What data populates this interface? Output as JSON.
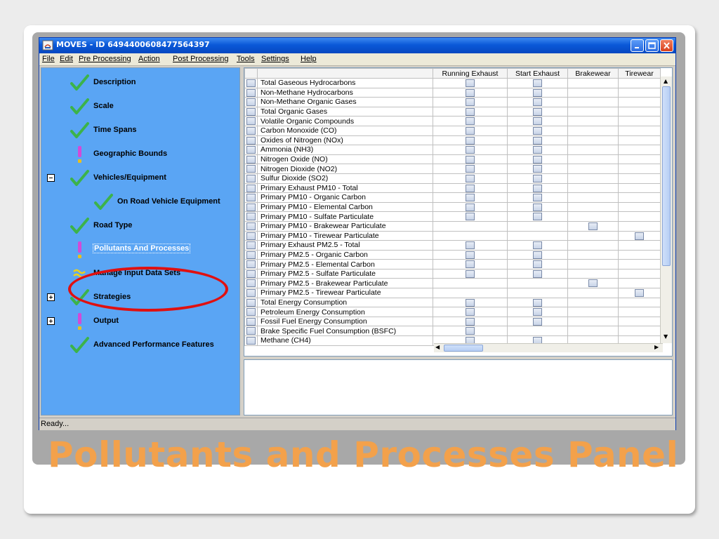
{
  "slide": {
    "title": "Pollutants and Processes Panel",
    "title_color": "#f3a14b"
  },
  "window": {
    "title": "MOVES - ID 6494400608477564397",
    "icon": "java-app-icon",
    "controls": [
      "minimize-icon",
      "maximize-icon",
      "close-icon"
    ]
  },
  "menu": [
    {
      "label": "File"
    },
    {
      "label": "Edit"
    },
    {
      "label": "Pre Processing"
    },
    {
      "label": "Action"
    },
    {
      "label": "Post Processing"
    },
    {
      "label": "Tools"
    },
    {
      "label": "Settings"
    },
    {
      "label": "Help"
    }
  ],
  "nav": {
    "items": [
      {
        "label": "Description",
        "status": "checkmark-icon"
      },
      {
        "label": "Scale",
        "status": "checkmark-icon"
      },
      {
        "label": "Time Spans",
        "status": "checkmark-icon"
      },
      {
        "label": "Geographic Bounds",
        "status": "exclamation-icon"
      },
      {
        "label": "Vehicles/Equipment",
        "status": "checkmark-icon",
        "expander": "collapse-icon"
      },
      {
        "label": "On Road Vehicle Equipment",
        "status": "checkmark-icon"
      },
      {
        "label": "Road Type",
        "status": "checkmark-icon"
      },
      {
        "label": "Pollutants And Processes",
        "status": "exclamation-icon",
        "selected": true
      },
      {
        "label": "Manage Input Data Sets",
        "status": "approx-icon"
      },
      {
        "label": "Strategies",
        "status": "checkmark-icon",
        "expander": "expand-icon"
      },
      {
        "label": "Output",
        "status": "exclamation-icon",
        "expander": "expand-icon"
      },
      {
        "label": "Advanced Performance Features",
        "status": "checkmark-icon"
      }
    ],
    "highlight_color": "#e01010"
  },
  "grid": {
    "columns": [
      "",
      "",
      "Running Exhaust",
      "Start Exhaust",
      "Brakewear",
      "Tirewear"
    ],
    "rows": [
      {
        "name": "Total Gaseous Hydrocarbons",
        "checks": [
          true,
          true,
          false,
          false
        ]
      },
      {
        "name": "Non-Methane Hydrocarbons",
        "checks": [
          true,
          true,
          false,
          false
        ]
      },
      {
        "name": "Non-Methane Organic Gases",
        "checks": [
          true,
          true,
          false,
          false
        ]
      },
      {
        "name": "Total Organic Gases",
        "checks": [
          true,
          true,
          false,
          false
        ]
      },
      {
        "name": "Volatile Organic Compounds",
        "checks": [
          true,
          true,
          false,
          false
        ]
      },
      {
        "name": "Carbon Monoxide (CO)",
        "checks": [
          true,
          true,
          false,
          false
        ]
      },
      {
        "name": "Oxides of Nitrogen (NOx)",
        "checks": [
          true,
          true,
          false,
          false
        ]
      },
      {
        "name": "Ammonia (NH3)",
        "checks": [
          true,
          true,
          false,
          false
        ]
      },
      {
        "name": "Nitrogen Oxide (NO)",
        "checks": [
          true,
          true,
          false,
          false
        ]
      },
      {
        "name": "Nitrogen Dioxide (NO2)",
        "checks": [
          true,
          true,
          false,
          false
        ]
      },
      {
        "name": "Sulfur Dioxide (SO2)",
        "checks": [
          true,
          true,
          false,
          false
        ]
      },
      {
        "name": "Primary Exhaust PM10  - Total",
        "checks": [
          true,
          true,
          false,
          false
        ]
      },
      {
        "name": "Primary PM10 - Organic Carbon",
        "checks": [
          true,
          true,
          false,
          false
        ]
      },
      {
        "name": "Primary PM10 - Elemental Carbon",
        "checks": [
          true,
          true,
          false,
          false
        ]
      },
      {
        "name": "Primary PM10 - Sulfate Particulate",
        "checks": [
          true,
          true,
          false,
          false
        ]
      },
      {
        "name": "Primary PM10 - Brakewear Particulate",
        "checks": [
          false,
          false,
          true,
          false
        ]
      },
      {
        "name": "Primary PM10 - Tirewear Particulate",
        "checks": [
          false,
          false,
          false,
          true
        ]
      },
      {
        "name": "Primary Exhaust PM2.5 - Total",
        "checks": [
          true,
          true,
          false,
          false
        ]
      },
      {
        "name": "Primary PM2.5 - Organic Carbon",
        "checks": [
          true,
          true,
          false,
          false
        ]
      },
      {
        "name": "Primary PM2.5 - Elemental Carbon",
        "checks": [
          true,
          true,
          false,
          false
        ]
      },
      {
        "name": "Primary PM2.5 - Sulfate Particulate",
        "checks": [
          true,
          true,
          false,
          false
        ]
      },
      {
        "name": "Primary PM2.5 - Brakewear Particulate",
        "checks": [
          false,
          false,
          true,
          false
        ]
      },
      {
        "name": "Primary PM2.5 - Tirewear Particulate",
        "checks": [
          false,
          false,
          false,
          true
        ]
      },
      {
        "name": "Total Energy Consumption",
        "checks": [
          true,
          true,
          false,
          false
        ]
      },
      {
        "name": "Petroleum Energy Consumption",
        "checks": [
          true,
          true,
          false,
          false
        ]
      },
      {
        "name": "Fossil Fuel Energy Consumption",
        "checks": [
          true,
          true,
          false,
          false
        ]
      },
      {
        "name": "Brake Specific Fuel Consumption (BSFC)",
        "checks": [
          true,
          false,
          false,
          false
        ]
      },
      {
        "name": "Methane (CH4)",
        "checks": [
          true,
          true,
          false,
          false
        ]
      }
    ]
  },
  "status": {
    "text": "Ready..."
  }
}
